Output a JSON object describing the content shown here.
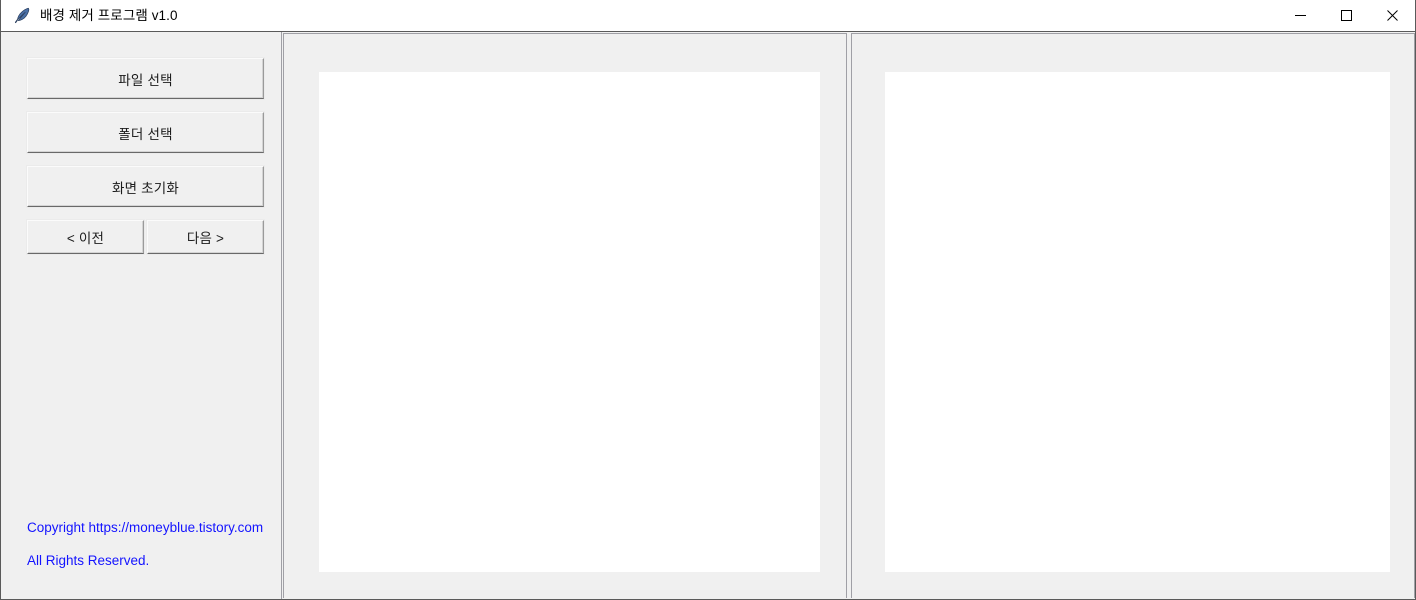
{
  "window": {
    "title": "배경 제거 프로그램 v1.0",
    "icon": "feather-quill-icon",
    "controls": {
      "minimize": "minimize-icon",
      "maximize": "maximize-icon",
      "close": "close-icon"
    }
  },
  "sidebar": {
    "buttons": [
      {
        "label": "파일 선택",
        "name": "select-file-button"
      },
      {
        "label": "폴더 선택",
        "name": "select-folder-button"
      },
      {
        "label": "화면 초기화",
        "name": "reset-screen-button"
      }
    ],
    "nav": {
      "prev_label": "< 이전",
      "next_label": "다음 >"
    },
    "copyright": {
      "line1": "Copyright https://moneyblue.tistory.com",
      "line2": "All Rights Reserved.",
      "color": "#1414ff"
    }
  },
  "panels": {
    "left": {
      "name": "original-image-preview",
      "content": ""
    },
    "right": {
      "name": "processed-image-preview",
      "content": ""
    }
  },
  "colors": {
    "window_background": "#f0f0f0",
    "titlebar_background": "#ffffff",
    "border": "#5a5a5a",
    "panel_border": "#a0a0a6",
    "canvas": "#ffffff",
    "link": "#1414ff"
  }
}
